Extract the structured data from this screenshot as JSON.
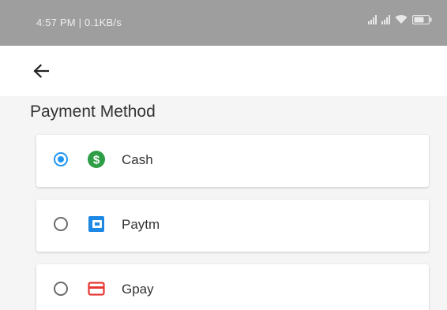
{
  "status_bar": {
    "time_text": "4:57 PM | 0.1KB/s",
    "icons": [
      "signal-icon",
      "signal-icon",
      "wifi-icon",
      "battery-icon"
    ]
  },
  "toolbar": {
    "back_icon": "arrow-left-icon"
  },
  "payment": {
    "title": "Payment Method",
    "selected": "Cash",
    "options": [
      {
        "label": "Cash",
        "icon": "cash-icon",
        "icon_color": "#2e9e46",
        "checked": true
      },
      {
        "label": "Paytm",
        "icon": "wallet-icon",
        "icon_color": "#1e88e5",
        "checked": false
      },
      {
        "label": "Gpay",
        "icon": "card-icon",
        "icon_color": "#e53935",
        "checked": false
      }
    ]
  },
  "colors": {
    "accent": "#2196f3",
    "status_bar_bg": "#9e9e9e",
    "content_bg": "#f5f5f5"
  }
}
